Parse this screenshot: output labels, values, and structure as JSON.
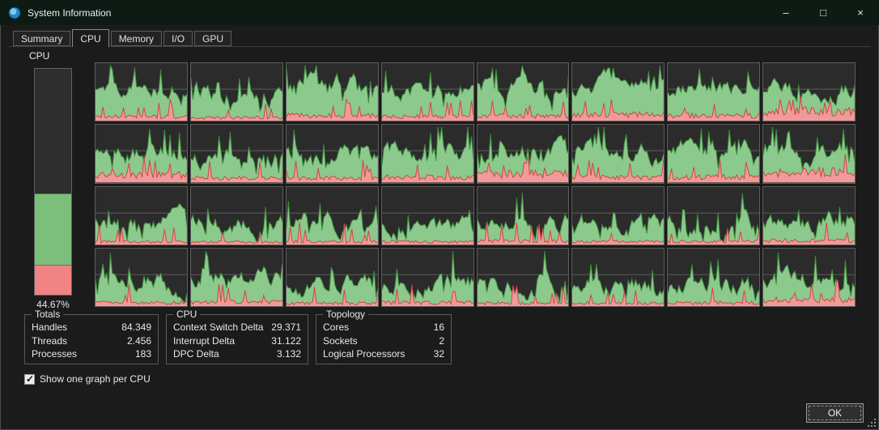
{
  "window": {
    "title": "System Information",
    "controls": {
      "minimize": "–",
      "maximize": "□",
      "close": "×"
    }
  },
  "tabs": [
    {
      "label": "Summary",
      "active": false
    },
    {
      "label": "CPU",
      "active": true
    },
    {
      "label": "Memory",
      "active": false
    },
    {
      "label": "I/O",
      "active": false
    },
    {
      "label": "GPU",
      "active": false
    }
  ],
  "cpu_panel": {
    "label": "CPU",
    "usage_percent": "44.67%",
    "bar": {
      "user_fraction": 0.313,
      "kernel_fraction": 0.134
    }
  },
  "graphs": {
    "rows": 4,
    "columns": 8,
    "seed": 1337,
    "cells": [
      {
        "g": 0.62,
        "r": 0.08
      },
      {
        "g": 0.45,
        "r": 0.06
      },
      {
        "g": 0.6,
        "r": 0.1
      },
      {
        "g": 0.58,
        "r": 0.08
      },
      {
        "g": 0.62,
        "r": 0.09
      },
      {
        "g": 0.6,
        "r": 0.12
      },
      {
        "g": 0.58,
        "r": 0.1
      },
      {
        "g": 0.6,
        "r": 0.18
      },
      {
        "g": 0.55,
        "r": 0.14
      },
      {
        "g": 0.52,
        "r": 0.08
      },
      {
        "g": 0.5,
        "r": 0.08
      },
      {
        "g": 0.52,
        "r": 0.1
      },
      {
        "g": 0.55,
        "r": 0.16
      },
      {
        "g": 0.5,
        "r": 0.1
      },
      {
        "g": 0.52,
        "r": 0.1
      },
      {
        "g": 0.55,
        "r": 0.2
      },
      {
        "g": 0.35,
        "r": 0.06
      },
      {
        "g": 0.33,
        "r": 0.05
      },
      {
        "g": 0.38,
        "r": 0.06
      },
      {
        "g": 0.35,
        "r": 0.06
      },
      {
        "g": 0.36,
        "r": 0.07
      },
      {
        "g": 0.34,
        "r": 0.06
      },
      {
        "g": 0.35,
        "r": 0.06
      },
      {
        "g": 0.4,
        "r": 0.08
      },
      {
        "g": 0.38,
        "r": 0.07
      },
      {
        "g": 0.5,
        "r": 0.08
      },
      {
        "g": 0.36,
        "r": 0.06
      },
      {
        "g": 0.38,
        "r": 0.07
      },
      {
        "g": 0.36,
        "r": 0.06
      },
      {
        "g": 0.35,
        "r": 0.06
      },
      {
        "g": 0.4,
        "r": 0.07
      },
      {
        "g": 0.45,
        "r": 0.12
      }
    ]
  },
  "totals": {
    "title": "Totals",
    "rows": [
      {
        "label": "Handles",
        "value": "84.349"
      },
      {
        "label": "Threads",
        "value": "2.456"
      },
      {
        "label": "Processes",
        "value": "183"
      }
    ]
  },
  "cpu_stats": {
    "title": "CPU",
    "rows": [
      {
        "label": "Context Switch Delta",
        "value": "29.371"
      },
      {
        "label": "Interrupt Delta",
        "value": "31.122"
      },
      {
        "label": "DPC Delta",
        "value": "3.132"
      }
    ]
  },
  "topology": {
    "title": "Topology",
    "rows": [
      {
        "label": "Cores",
        "value": "16"
      },
      {
        "label": "Sockets",
        "value": "2"
      },
      {
        "label": "Logical Processors",
        "value": "32"
      }
    ]
  },
  "footer": {
    "checkbox_label": "Show one graph per CPU",
    "checkbox_checked": true,
    "ok_label": "OK"
  },
  "colors": {
    "titlebar_bg": "#0e1b14",
    "window_bg": "#1b1b1b",
    "graph_green_fill": "#8cc98c",
    "graph_green_line": "#3f8f3f",
    "graph_red_fill": "#f09a9a",
    "graph_red_line": "#cc4747",
    "cell_bg": "#2b2b2b",
    "cell_border": "#5e5e5e",
    "grid_line": "#9a9a9a",
    "bar_user": "#7cbf7c",
    "bar_kernel": "#f08484",
    "bar_idle": "#2e2e2e"
  }
}
